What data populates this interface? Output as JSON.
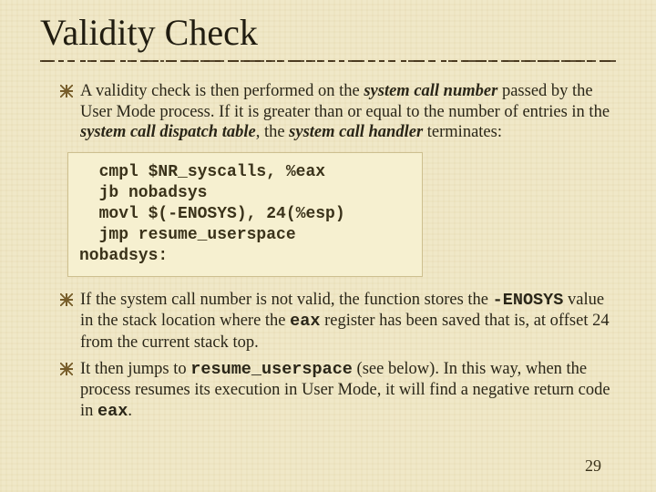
{
  "title": "Validity Check",
  "bullets": {
    "p1": {
      "pre": "A validity check is then performed on the ",
      "em1": "system call number",
      "mid1": " passed by the User Mode process. If it is greater than or equal to the number of entries in the ",
      "em2": "system call dispatch table",
      "mid2": ", the ",
      "em3": "system call handler",
      "post": " terminates:"
    },
    "p2": {
      "pre": "If the system call number is not valid, the function stores the ",
      "code1": "-ENOSYS",
      "mid1": " value in the stack location where the ",
      "code2": "eax",
      "post": " register has been saved that is, at offset 24 from the current stack top."
    },
    "p3": {
      "pre": "It then jumps to ",
      "code1": "resume_userspace",
      "mid1": " (see below). In this way, when the process resumes its execution in User Mode, it will find a negative return code in ",
      "code2": "eax",
      "post": "."
    }
  },
  "code": "  cmpl $NR_syscalls, %eax\n  jb nobadsys\n  movl $(-ENOSYS), 24(%esp)\n  jmp resume_userspace\nnobadsys:",
  "pagenum": "29"
}
